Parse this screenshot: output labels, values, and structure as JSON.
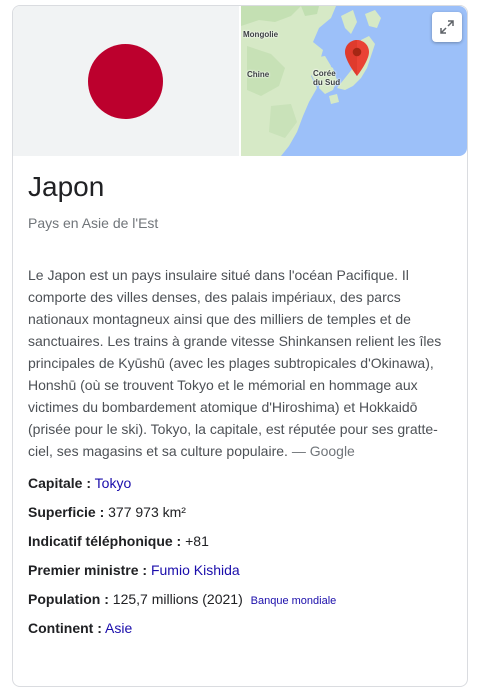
{
  "entity": {
    "title": "Japon",
    "subtitle": "Pays en Asie de l'Est"
  },
  "map": {
    "labels": {
      "mongolia": "Mongolie",
      "china": "Chine",
      "korea_line1": "Corée",
      "korea_line2": "du Sud"
    },
    "colors": {
      "sea": "#9cc0f9",
      "land": "#d6e9c6",
      "land_dark": "#bcdcab",
      "pin": "#ea4335"
    }
  },
  "flag": {
    "colors": {
      "background": "#f1f3f4",
      "disc": "#bc002d"
    }
  },
  "description": {
    "text": "Le Japon est un pays insulaire situé dans l'océan Pacifique. Il comporte des villes denses, des palais impériaux, des parcs nationaux montagneux ainsi que des milliers de temples et de sanctuaires. Les trains à grande vitesse Shinkansen relient les îles principales de Kyūshū (avec les plages subtropicales d'Okinawa), Honshū (où se trouvent Tokyo et le mémorial en hommage aux victimes du bombardement atomique d'Hiroshima) et Hokkaidō (prisée pour le ski). Tokyo, la capitale, est réputée pour ses gratte-ciel, ses magasins et sa culture populaire.",
    "source": "— Google"
  },
  "facts": {
    "capital": {
      "label": "Capitale :",
      "value": "Tokyo"
    },
    "area": {
      "label": "Superficie :",
      "value": "377 973 km²"
    },
    "dial": {
      "label": "Indicatif téléphonique :",
      "value": "+81"
    },
    "pm": {
      "label": "Premier ministre :",
      "value": "Fumio Kishida"
    },
    "population": {
      "label": "Population :",
      "value": "125,7 millions (2021)",
      "source": "Banque mondiale"
    },
    "continent": {
      "label": "Continent :",
      "value": "Asie"
    }
  },
  "colors": {
    "link": "#1a0dab",
    "text": "#202124",
    "muted": "#70757a"
  }
}
